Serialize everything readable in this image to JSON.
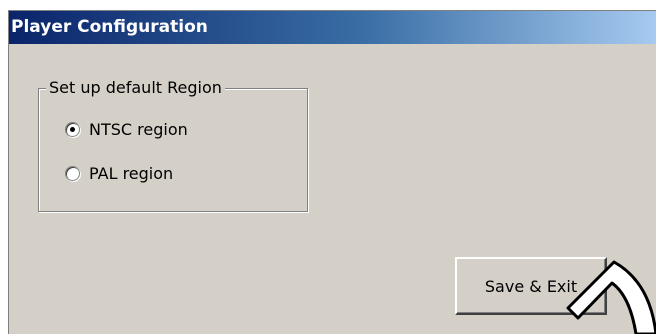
{
  "window": {
    "title": "Player Configuration",
    "colors": {
      "titlebar_start": "#0a246a",
      "titlebar_end": "#a6caf0",
      "face": "#d4d0c8"
    }
  },
  "region_group": {
    "label": "Set up default Region",
    "options": [
      {
        "label": "NTSC region",
        "selected": true
      },
      {
        "label": "PAL region",
        "selected": false
      }
    ]
  },
  "actions": {
    "save_exit_label": "Save & Exit"
  }
}
